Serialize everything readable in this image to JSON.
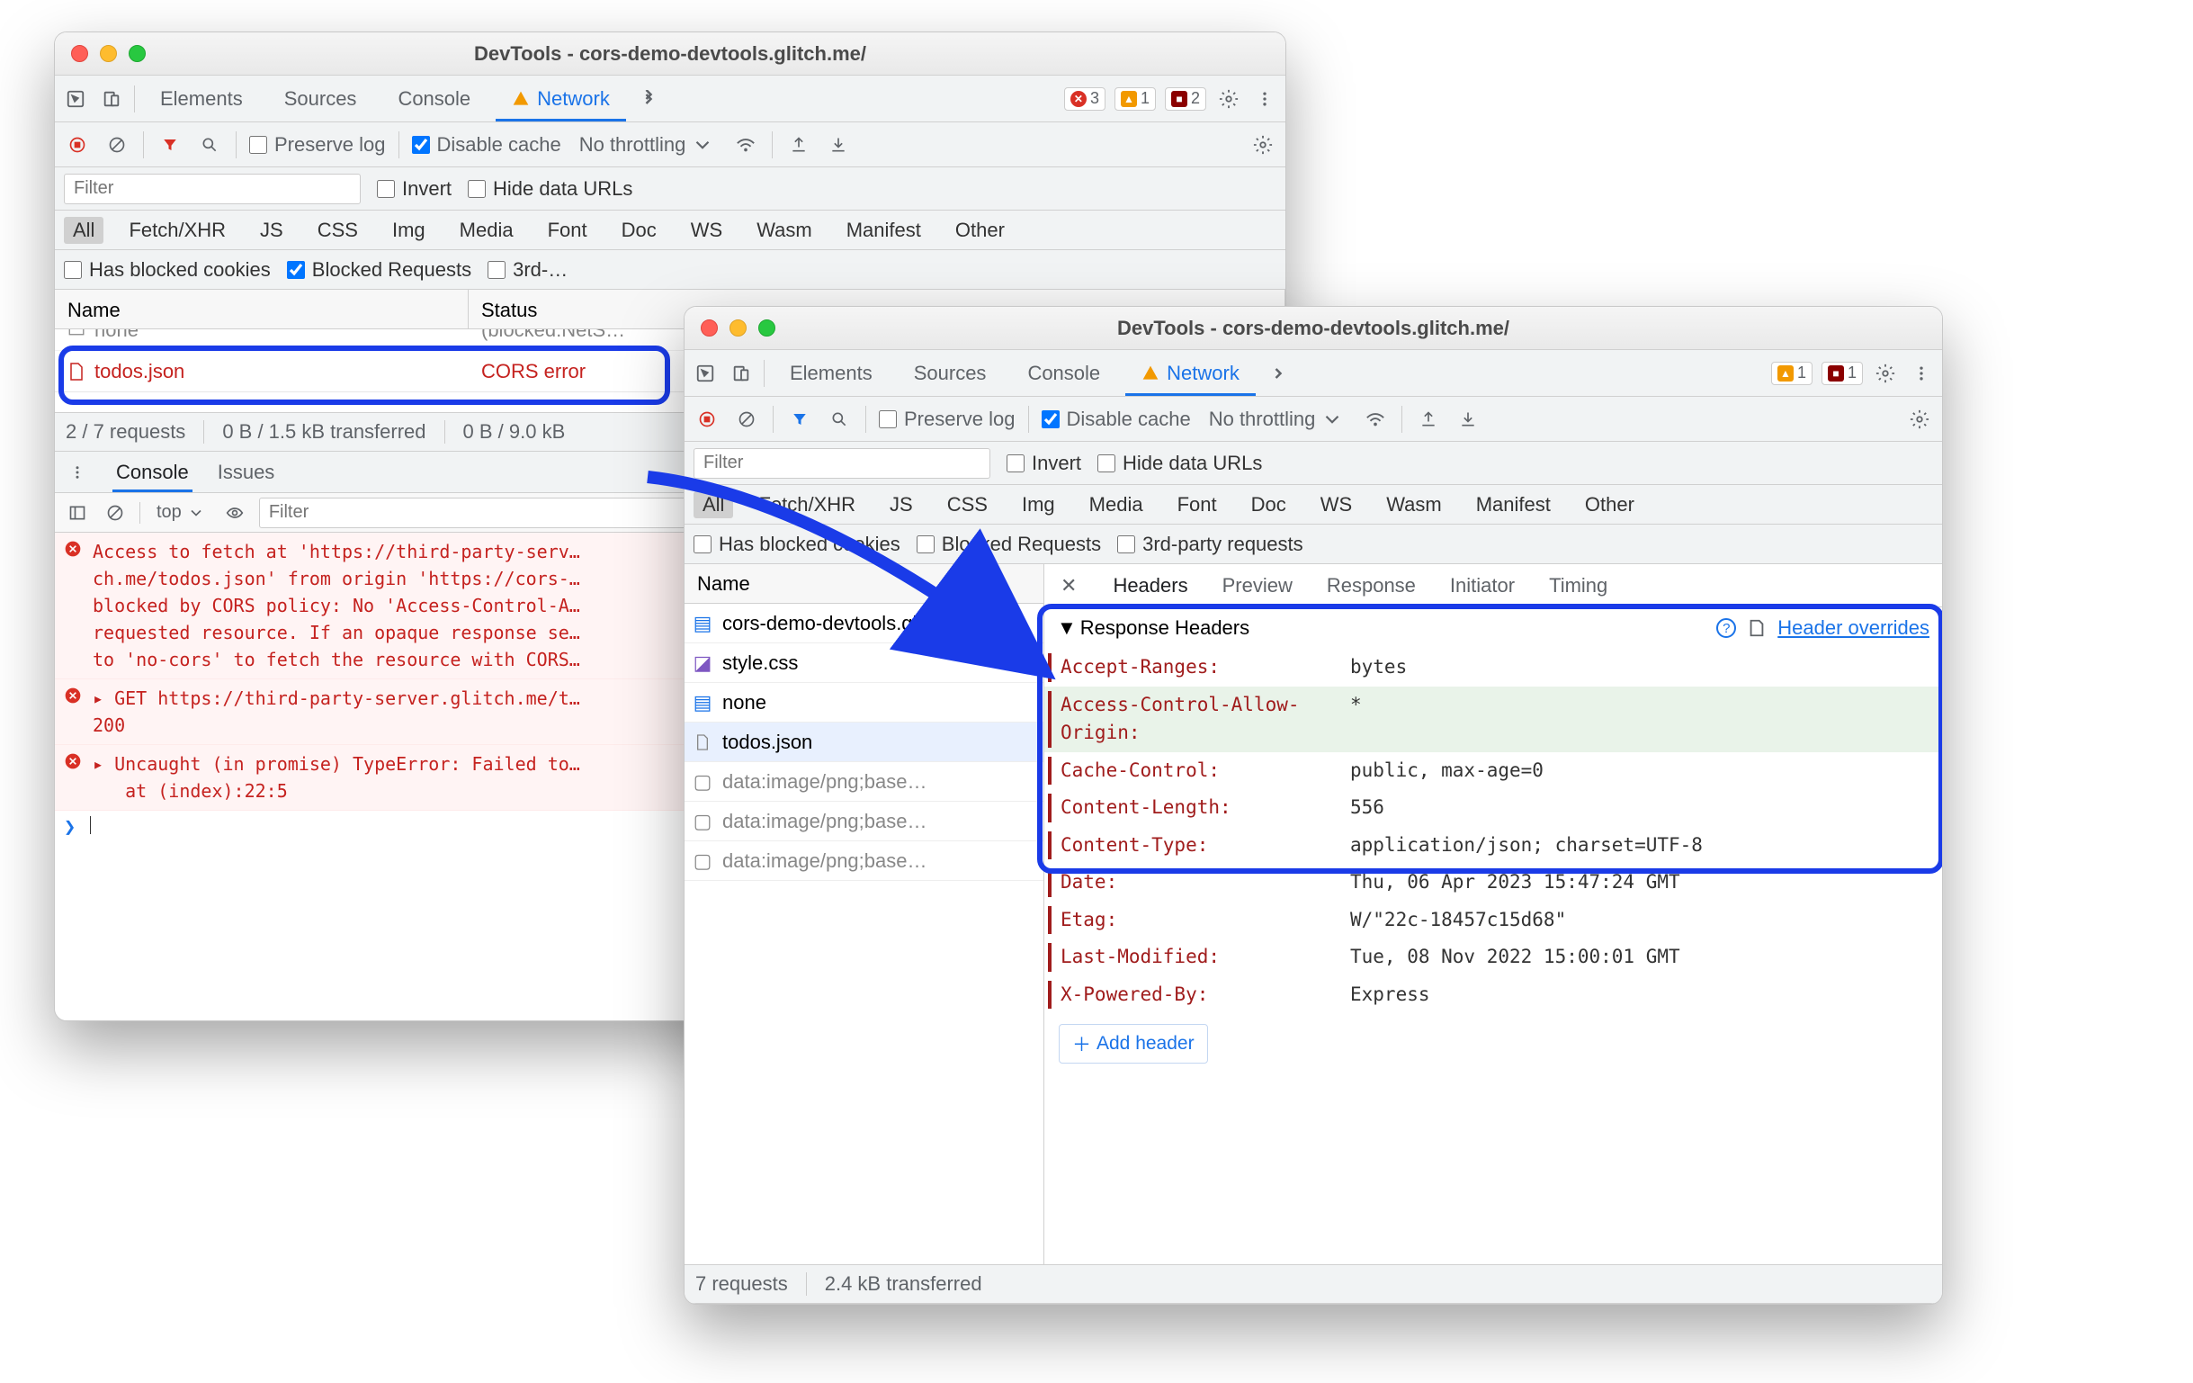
{
  "window1": {
    "title": "DevTools - cors-demo-devtools.glitch.me/",
    "mainTabs": [
      "Elements",
      "Sources",
      "Console",
      "Network"
    ],
    "activeTab": "Network",
    "errorBadges": {
      "errors": "3",
      "warnings": "1",
      "blocked": "2"
    },
    "toolbar": {
      "preserveLog": "Preserve log",
      "disableCache": "Disable cache",
      "throttling": "No throttling"
    },
    "filterRow": {
      "filterPlaceholder": "Filter",
      "invert": "Invert",
      "hideDataUrls": "Hide data URLs"
    },
    "typeFilters": [
      "All",
      "Fetch/XHR",
      "JS",
      "CSS",
      "Img",
      "Media",
      "Font",
      "Doc",
      "WS",
      "Wasm",
      "Manifest",
      "Other"
    ],
    "moreFilters": {
      "blockedCookies": "Has blocked cookies",
      "blockedRequests": "Blocked Requests",
      "thirdParty": "3rd-…"
    },
    "columns": {
      "name": "Name",
      "status": "Status"
    },
    "rows": [
      {
        "name": "none",
        "status": "(blocked:NetS…",
        "cut": true
      },
      {
        "name": "todos.json",
        "status": "CORS error",
        "color": "#c5221f",
        "highlight": true
      }
    ],
    "status": {
      "requests": "2 / 7 requests",
      "transferred": "0 B / 1.5 kB transferred",
      "resources": "0 B / 9.0 kB"
    },
    "drawerTabs": [
      "Console",
      "Issues"
    ],
    "consoleContext": "top",
    "consoleFilterPlaceholder": "Filter",
    "consoleMessages": [
      {
        "type": "error",
        "text": "Access to fetch at 'https://third-party-serv…\nch.me/todos.json' from origin 'https://cors-…\nblocked by CORS policy: No 'Access-Control-A…\nrequested resource. If an opaque response se…\nto 'no-cors' to fetch the resource with CORS…"
      },
      {
        "type": "error",
        "text": "▸ GET https://third-party-server.glitch.me/t…\n200"
      },
      {
        "type": "error",
        "text": "▸ Uncaught (in promise) TypeError: Failed to…\n   at (index):22:5"
      }
    ]
  },
  "window2": {
    "title": "DevTools - cors-demo-devtools.glitch.me/",
    "mainTabs": [
      "Elements",
      "Sources",
      "Console",
      "Network"
    ],
    "activeTab": "Network",
    "errorBadges": {
      "warnings": "1",
      "blocked": "1"
    },
    "toolbar": {
      "preserveLog": "Preserve log",
      "disableCache": "Disable cache",
      "throttling": "No throttling"
    },
    "filterRow": {
      "filterPlaceholder": "Filter",
      "invert": "Invert",
      "hideDataUrls": "Hide data URLs"
    },
    "typeFilters": [
      "All",
      "Fetch/XHR",
      "JS",
      "CSS",
      "Img",
      "Media",
      "Font",
      "Doc",
      "WS",
      "Wasm",
      "Manifest",
      "Other"
    ],
    "moreFilters": {
      "blockedCookies": "Has blocked cookies",
      "blockedRequests": "Blocked Requests",
      "thirdParty": "3rd-party requests"
    },
    "requestList": {
      "header": "Name",
      "items": [
        {
          "name": "cors-demo-devtools.glitch.me",
          "icon": "doc",
          "color": "#1a73e8"
        },
        {
          "name": "style.css",
          "icon": "css",
          "color": "#7e57c2"
        },
        {
          "name": "none",
          "icon": "doc",
          "color": "#1a73e8"
        },
        {
          "name": "todos.json",
          "icon": "file",
          "selected": true
        },
        {
          "name": "data:image/png;base…",
          "icon": "img",
          "dim": true
        },
        {
          "name": "data:image/png;base…",
          "icon": "img",
          "dim": true
        },
        {
          "name": "data:image/png;base…",
          "icon": "img",
          "dim": true
        }
      ]
    },
    "detailTabs": [
      "Headers",
      "Preview",
      "Response",
      "Initiator",
      "Timing"
    ],
    "activeDetail": "Headers",
    "responseHeadersLabel": "Response Headers",
    "headerOverridesLink": "Header overrides",
    "headers": [
      {
        "k": "Accept-Ranges:",
        "v": "bytes"
      },
      {
        "k": "Access-Control-Allow-Origin:",
        "v": "*",
        "override": true
      },
      {
        "k": "Cache-Control:",
        "v": "public, max-age=0"
      },
      {
        "k": "Content-Length:",
        "v": "556"
      },
      {
        "k": "Content-Type:",
        "v": "application/json; charset=UTF-8"
      },
      {
        "k": "Date:",
        "v": "Thu, 06 Apr 2023 15:47:24 GMT"
      },
      {
        "k": "Etag:",
        "v": "W/\"22c-18457c15d68\""
      },
      {
        "k": "Last-Modified:",
        "v": "Tue, 08 Nov 2022 15:00:01 GMT"
      },
      {
        "k": "X-Powered-By:",
        "v": "Express"
      }
    ],
    "addHeader": "Add header",
    "status": {
      "requests": "7 requests",
      "transferred": "2.4 kB transferred"
    }
  }
}
